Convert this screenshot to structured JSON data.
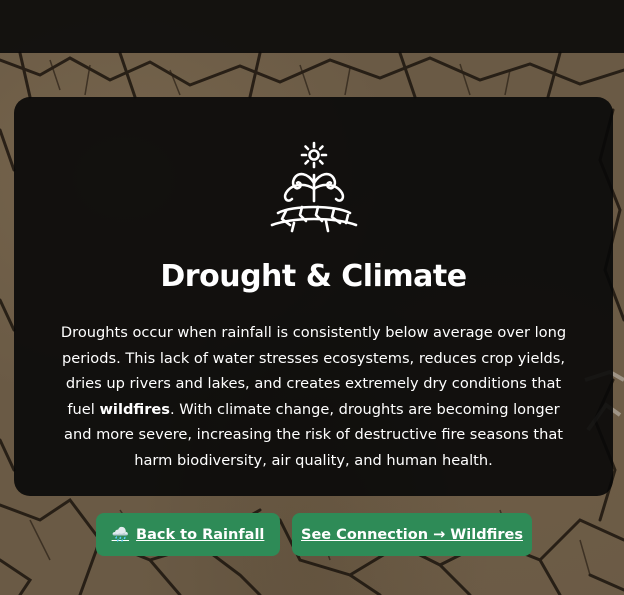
{
  "card": {
    "icon": "drought-plant-sun-icon",
    "title": "Drought & Climate",
    "body_part1": "Droughts occur when rainfall is consistently below average over long periods. This lack of water stresses ecosystems, reduces crop yields, dries up rivers and lakes, and creates extremely dry conditions that fuel ",
    "body_bold": "wildfires",
    "body_part2": ". With climate change, droughts are becoming longer and more severe, increasing the risk of destructive fire seasons that harm biodiversity, air quality, and human health."
  },
  "nav": {
    "back_icon": "🌧️",
    "back_label": "Back to Rainfall",
    "next_label": "See Connection → Wildfires"
  },
  "colors": {
    "card_bg": "#080808",
    "button_bg": "#2e8b57",
    "text": "#ffffff",
    "earth": "#6a5a45"
  }
}
